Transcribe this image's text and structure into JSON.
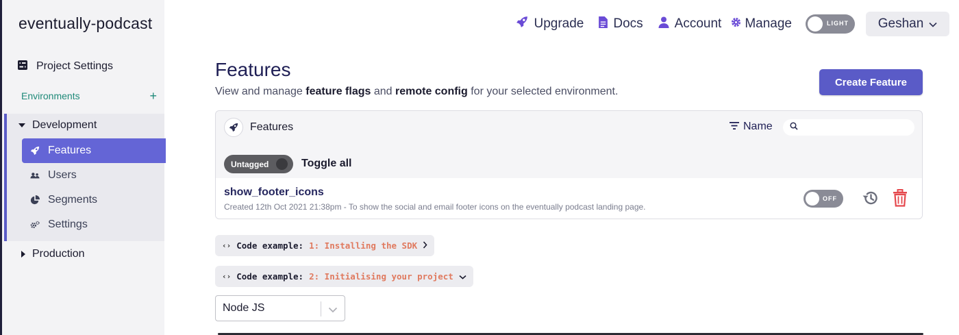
{
  "sidebar": {
    "project_title": "eventually-podcast",
    "project_settings_label": "Project Settings",
    "environments_label": "Environments",
    "add_env_symbol": "+",
    "development_label": "Development",
    "production_label": "Production",
    "nav_items": [
      {
        "label": "Features",
        "icon": "rocket-icon",
        "active": true
      },
      {
        "label": "Users",
        "icon": "users-icon",
        "active": false
      },
      {
        "label": "Segments",
        "icon": "pie-chart-icon",
        "active": false
      },
      {
        "label": "Settings",
        "icon": "cogs-icon",
        "active": false
      }
    ]
  },
  "topnav": {
    "upgrade_label": "Upgrade",
    "docs_label": "Docs",
    "account_label": "Account",
    "manage_label": "Manage",
    "theme_label": "LIGHT",
    "user_label": "Geshan"
  },
  "main": {
    "title": "Features",
    "subtitle_prefix": "View and manage ",
    "subtitle_bold1": "feature flags",
    "subtitle_mid": " and ",
    "subtitle_bold2": "remote config",
    "subtitle_suffix": " for your selected environment.",
    "create_button_label": "Create Feature"
  },
  "panel": {
    "header_label": "Features",
    "sort_label": "Name",
    "search_placeholder": "",
    "tag_label": "Untagged",
    "toggle_all_label": "Toggle all",
    "features": [
      {
        "name": "show_footer_icons",
        "description": "Created 12th Oct 2021 21:38pm - To show the social and email footer icons on the eventually podcast landing page.",
        "state_label": "OFF",
        "enabled": false
      }
    ]
  },
  "code_examples": [
    {
      "prefix": "Code example:",
      "step": "1: Installing the SDK",
      "expanded": false
    },
    {
      "prefix": "Code example:",
      "step": "2: Initialising your project",
      "expanded": true
    }
  ],
  "language_select": {
    "value": "Node JS"
  },
  "colors": {
    "accent": "#5a5bc7",
    "active_nav": "#6465d6",
    "env_teal": "#1f8a79",
    "code_orange": "#e07a5f",
    "danger": "#e5484d"
  }
}
